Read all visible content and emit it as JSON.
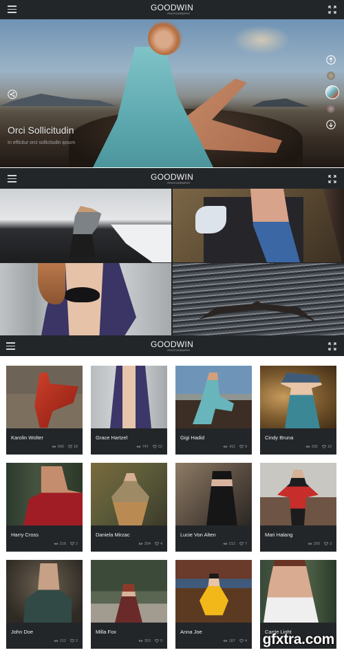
{
  "app": {
    "brand_name": "GOODWIN",
    "brand_tagline": "PHOTOGRAPHY"
  },
  "headers": [
    {
      "menu_icon": "hamburger-icon",
      "fullscreen_icon": "fullscreen-icon"
    },
    {
      "menu_icon": "hamburger-icon",
      "fullscreen_icon": "fullscreen-icon"
    },
    {
      "menu_icon": "hamburger-icon",
      "fullscreen_icon": "fullscreen-icon"
    }
  ],
  "hero": {
    "title": "Orci Sollicitudin",
    "subtitle": "In efficitur orci sollicitudin ipsum",
    "icons": {
      "share": "share-icon",
      "prev": "arrow-up-icon",
      "next": "arrow-down-icon"
    },
    "thumbnails_count": 3,
    "active_thumbnail": 2
  },
  "mosaic": {
    "tiles": [
      {
        "subject": "photographer on black sand beach"
      },
      {
        "subject": "couple on blanket"
      },
      {
        "subject": "woman in purple coat"
      },
      {
        "subject": "whale tail in ocean"
      }
    ]
  },
  "gallery": {
    "cards": [
      {
        "name": "Karolin Wolter",
        "views": "999",
        "likes": "18"
      },
      {
        "name": "Grace Hartzel",
        "views": "747",
        "likes": "22"
      },
      {
        "name": "Gigi Hadid",
        "views": "411",
        "likes": "9"
      },
      {
        "name": "Cindy Bruna",
        "views": "292",
        "likes": "10"
      },
      {
        "name": "Harry Cross",
        "views": "216",
        "likes": "2"
      },
      {
        "name": "Daniela Mirzac",
        "views": "264",
        "likes": "4"
      },
      {
        "name": "Lucie Von Alten",
        "views": "212",
        "likes": "7"
      },
      {
        "name": "Mari Halang",
        "views": "200",
        "likes": "3"
      },
      {
        "name": "John Doe",
        "views": "212",
        "likes": "2"
      },
      {
        "name": "Milla Fox",
        "views": "303",
        "likes": "9"
      },
      {
        "name": "Anna Joe",
        "views": "187",
        "likes": "4"
      },
      {
        "name": "Carrie Light",
        "views": "",
        "likes": ""
      }
    ],
    "stat_icons": {
      "views": "eye-icon",
      "likes": "heart-icon"
    }
  },
  "watermark": "gfxtra.com",
  "colors": {
    "header_bg": "#232629",
    "card_bg": "#232629",
    "text_light": "#f0f0f0",
    "text_muted": "#8f9499",
    "page_bg": "#ffffff"
  }
}
